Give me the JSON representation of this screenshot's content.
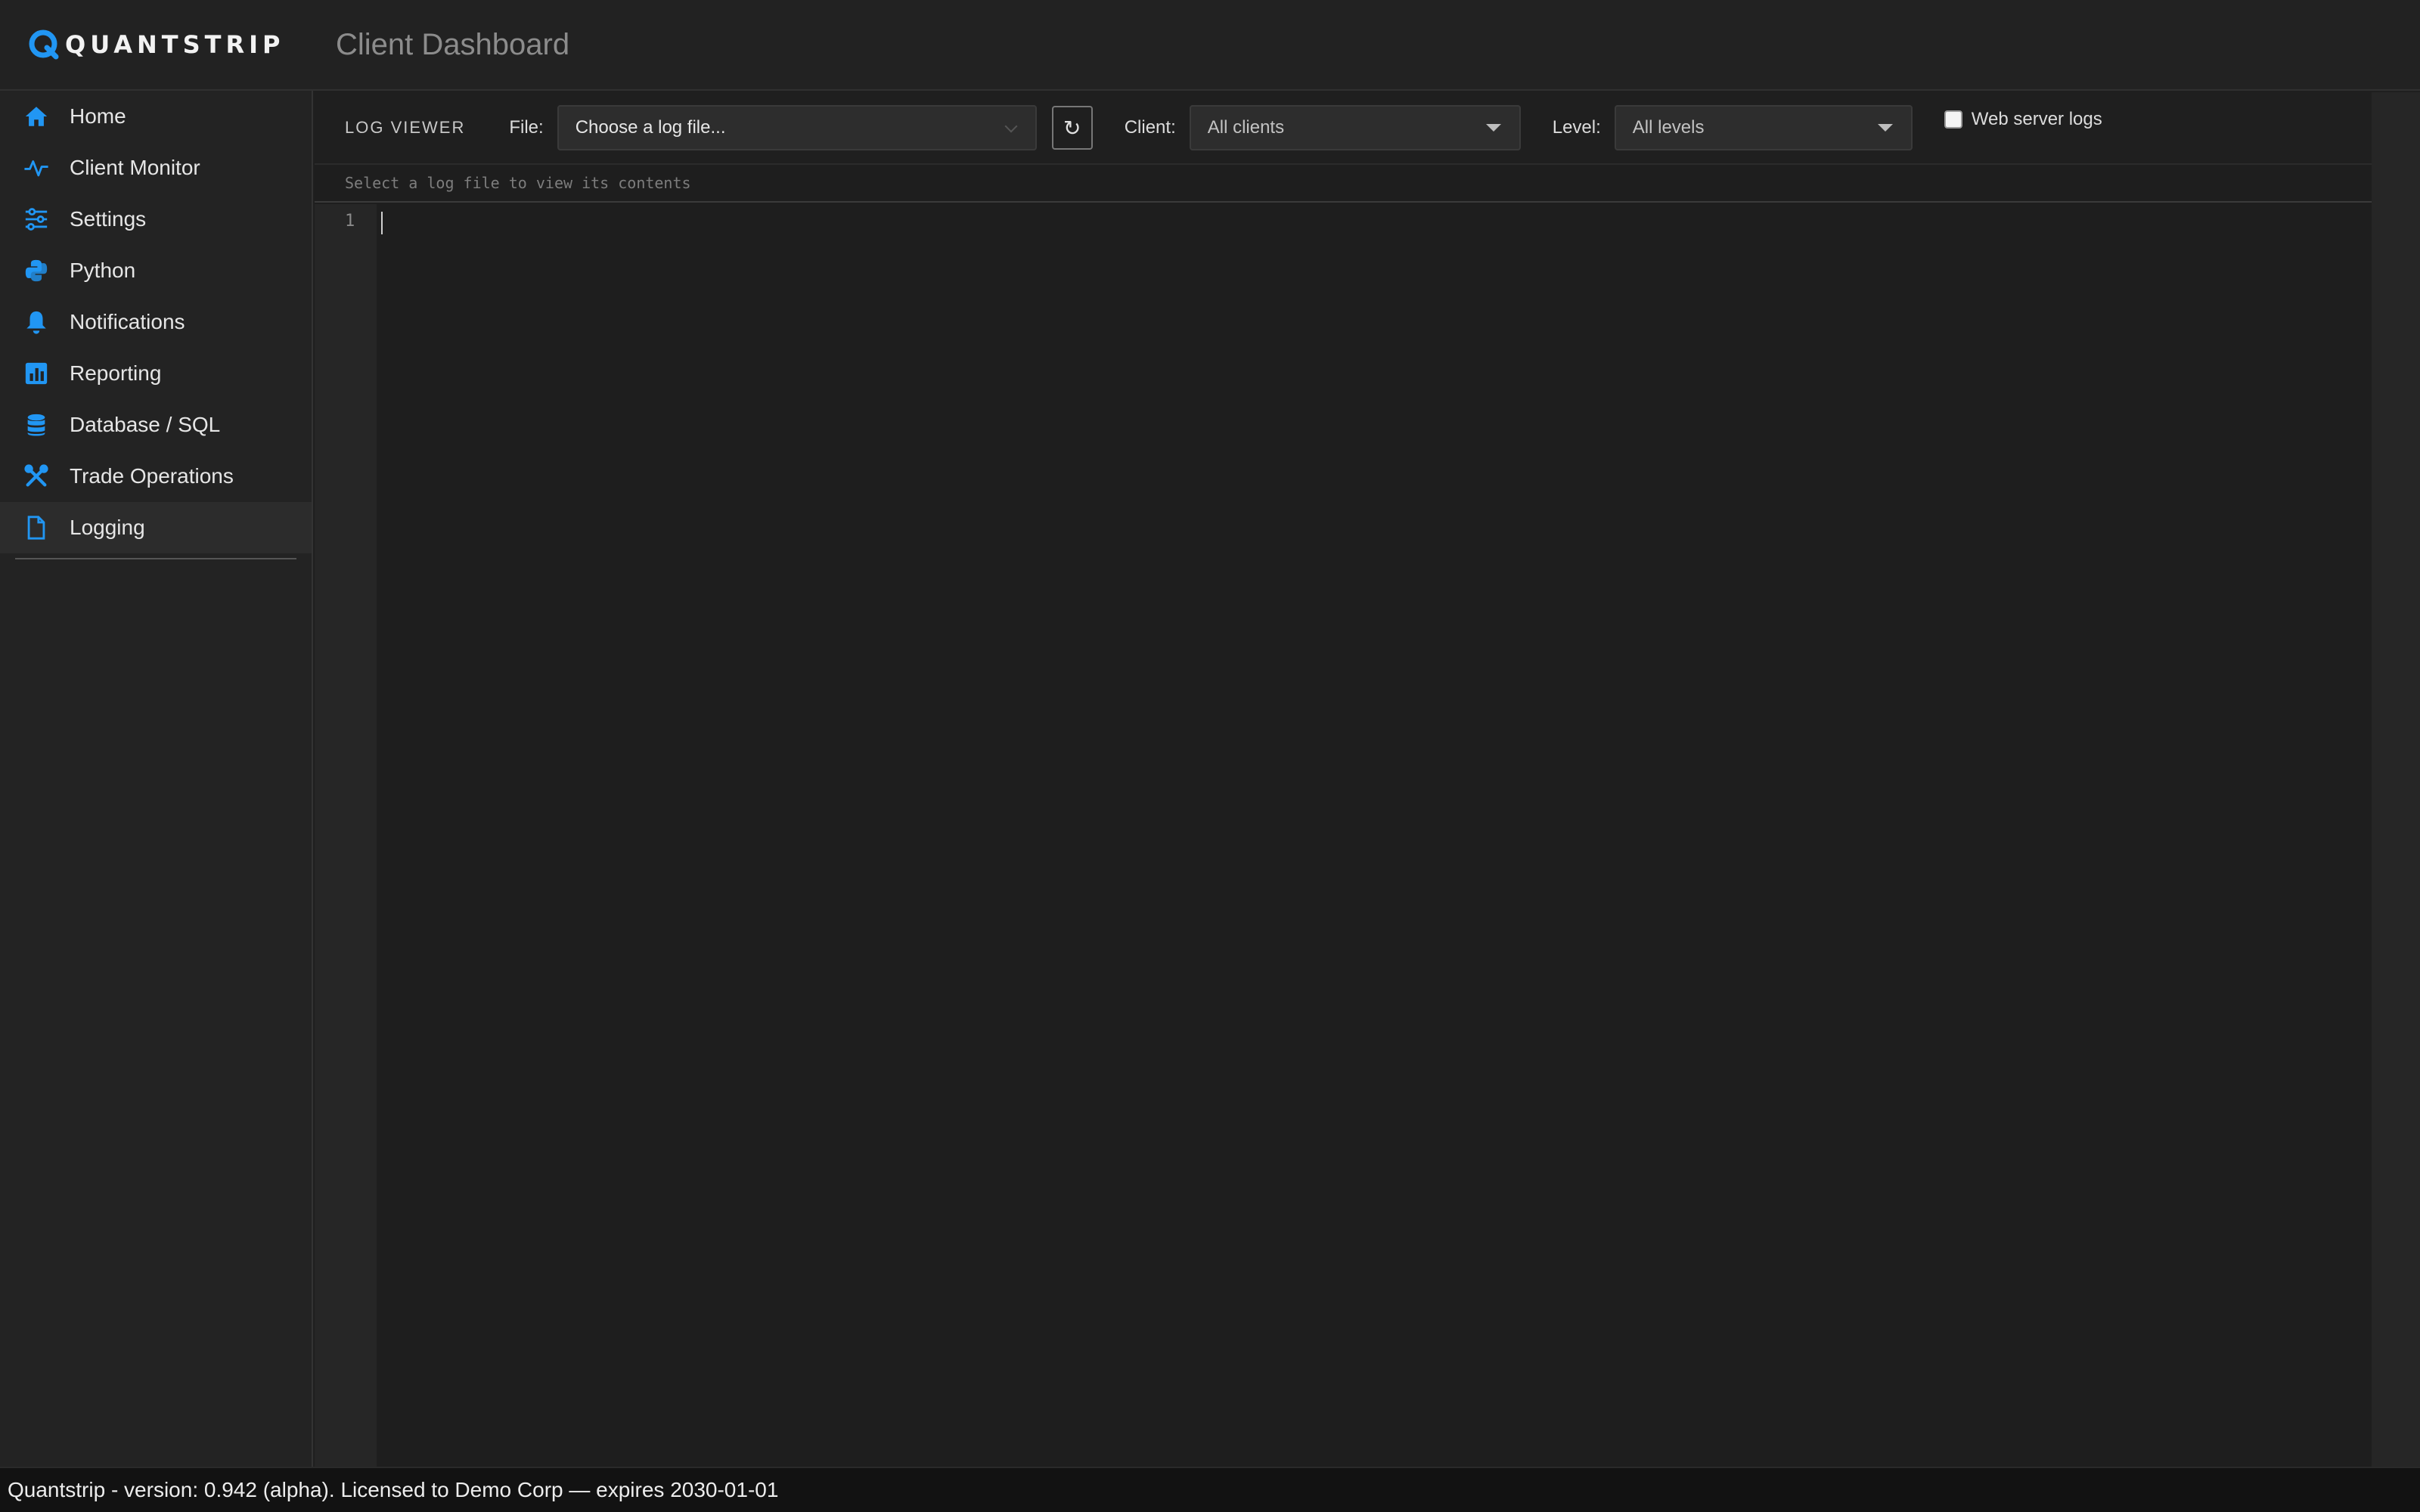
{
  "app": {
    "brand": "QUANTSTRIP",
    "title": "Client Dashboard"
  },
  "sidebar": {
    "items": [
      {
        "label": "Home",
        "icon": "home-icon"
      },
      {
        "label": "Client Monitor",
        "icon": "pulse-icon"
      },
      {
        "label": "Settings",
        "icon": "sliders-icon"
      },
      {
        "label": "Python",
        "icon": "python-icon"
      },
      {
        "label": "Notifications",
        "icon": "bell-icon"
      },
      {
        "label": "Reporting",
        "icon": "chart-icon"
      },
      {
        "label": "Database / SQL",
        "icon": "database-icon"
      },
      {
        "label": "Trade Operations",
        "icon": "tools-icon"
      },
      {
        "label": "Logging",
        "icon": "file-icon",
        "active": true
      }
    ]
  },
  "toolbar": {
    "title": "LOG VIEWER",
    "file_label": "File:",
    "file_value": "Choose a log file...",
    "refresh_glyph": "↻",
    "client_label": "Client:",
    "client_value": "All clients",
    "level_label": "Level:",
    "level_value": "All levels",
    "webserver_label": "Web server logs",
    "webserver_checked": false
  },
  "viewer": {
    "status": "Select a log file to view its contents",
    "line_number": "1"
  },
  "footer": {
    "text": "Quantstrip - version: 0.942 (alpha). Licensed to Demo Corp — expires 2030-01-01"
  },
  "colors": {
    "accent": "#2196f3",
    "background": "#1f1f1f"
  }
}
